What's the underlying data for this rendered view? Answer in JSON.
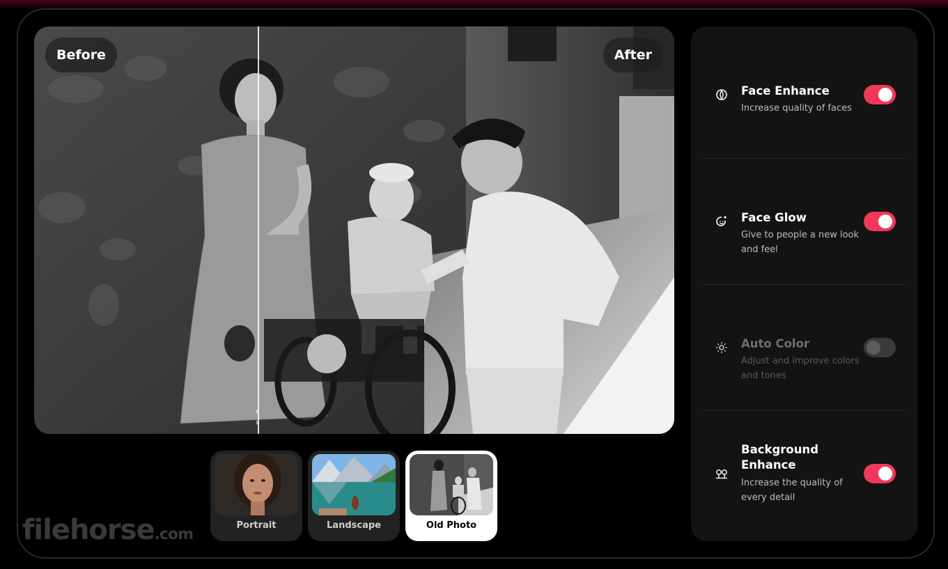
{
  "compare": {
    "before_label": "Before",
    "after_label": "After",
    "handle_glyph": "‹ ›"
  },
  "samples": [
    {
      "label": "Portrait",
      "icon": "portrait-thumbnail",
      "selected": false
    },
    {
      "label": "Landscape",
      "icon": "landscape-thumbnail",
      "selected": false
    },
    {
      "label": "Old Photo",
      "icon": "old-photo-thumbnail",
      "selected": true
    }
  ],
  "watermark": {
    "text": "filehorse",
    "suffix": ".com"
  },
  "settings": [
    {
      "title": "Face Enhance",
      "description": "Increase quality of faces",
      "icon": "face-enhance-icon",
      "enabled": true
    },
    {
      "title": "Face Glow",
      "description": "Give to people a new look and feel",
      "icon": "face-glow-icon",
      "enabled": true
    },
    {
      "title": "Auto Color",
      "description": "Adjust and improve colors and tones",
      "icon": "sun-icon",
      "enabled": false
    },
    {
      "title": "Background Enhance",
      "description": "Increase the quality of every detail",
      "icon": "background-enhance-icon",
      "enabled": true
    }
  ],
  "colors": {
    "accent": "#f2385a",
    "panel": "#131313",
    "toggle_off": "#3a3a3a"
  }
}
